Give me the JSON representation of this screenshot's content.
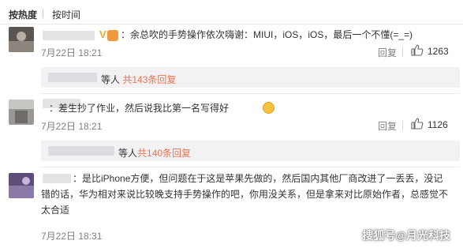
{
  "sort": {
    "hot_label": "按热度",
    "time_label": "按时间"
  },
  "comments": [
    {
      "text": "：余总吹的手势操作依次嗨谢：MIUI，iOS，iOS，最后一个不懂(=_=)",
      "time": "7月22日 18:21",
      "reply_label": "回复",
      "likes": "1263",
      "thread": {
        "prefix": "等人",
        "link": "共143条回复"
      }
    },
    {
      "text": "：差生抄了作业，然后说我比第一名写得好",
      "time": "7月22日 18:21",
      "reply_label": "回复",
      "likes": "1126",
      "thread": {
        "prefix": "等人",
        "link": "共140条回复"
      }
    },
    {
      "text_line1": "：是比iPhone方便，但问题在于这是苹果先做的，然后国内其他厂商改进了一丢丢，没记",
      "text_line2": "错的话，华为相对来说比较晚支持手势操作的吧，你用没关系，但是拿来对比原始作者，总感觉不",
      "text_line3": "太合适",
      "time": "7月22日 18:31"
    }
  ],
  "watermark": "搜狐号@月光科技",
  "colors": {
    "accent": "#eb7350",
    "muted": "#808080",
    "reply_bg": "#f2f2f5"
  }
}
